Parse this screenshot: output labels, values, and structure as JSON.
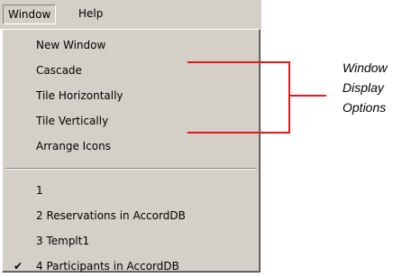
{
  "menubar": {
    "items": [
      {
        "label": "Window",
        "state": "open"
      },
      {
        "label": "Help"
      }
    ]
  },
  "window_menu": {
    "display_options": [
      "New Window",
      "Cascade",
      "Tile Horizontally",
      "Tile Vertically",
      "Arrange Icons"
    ],
    "open_windows": [
      {
        "label": "1",
        "checked": false
      },
      {
        "label": "2 Reservations in AccordDB",
        "checked": false
      },
      {
        "label": "3 Templt1",
        "checked": false
      },
      {
        "label": "4 Participants in AccordDB",
        "checked": true
      }
    ],
    "check_icon": "checkmark-icon"
  },
  "callout": {
    "lines": [
      "Window",
      "Display",
      "Options"
    ],
    "color": "#e21a1a"
  }
}
